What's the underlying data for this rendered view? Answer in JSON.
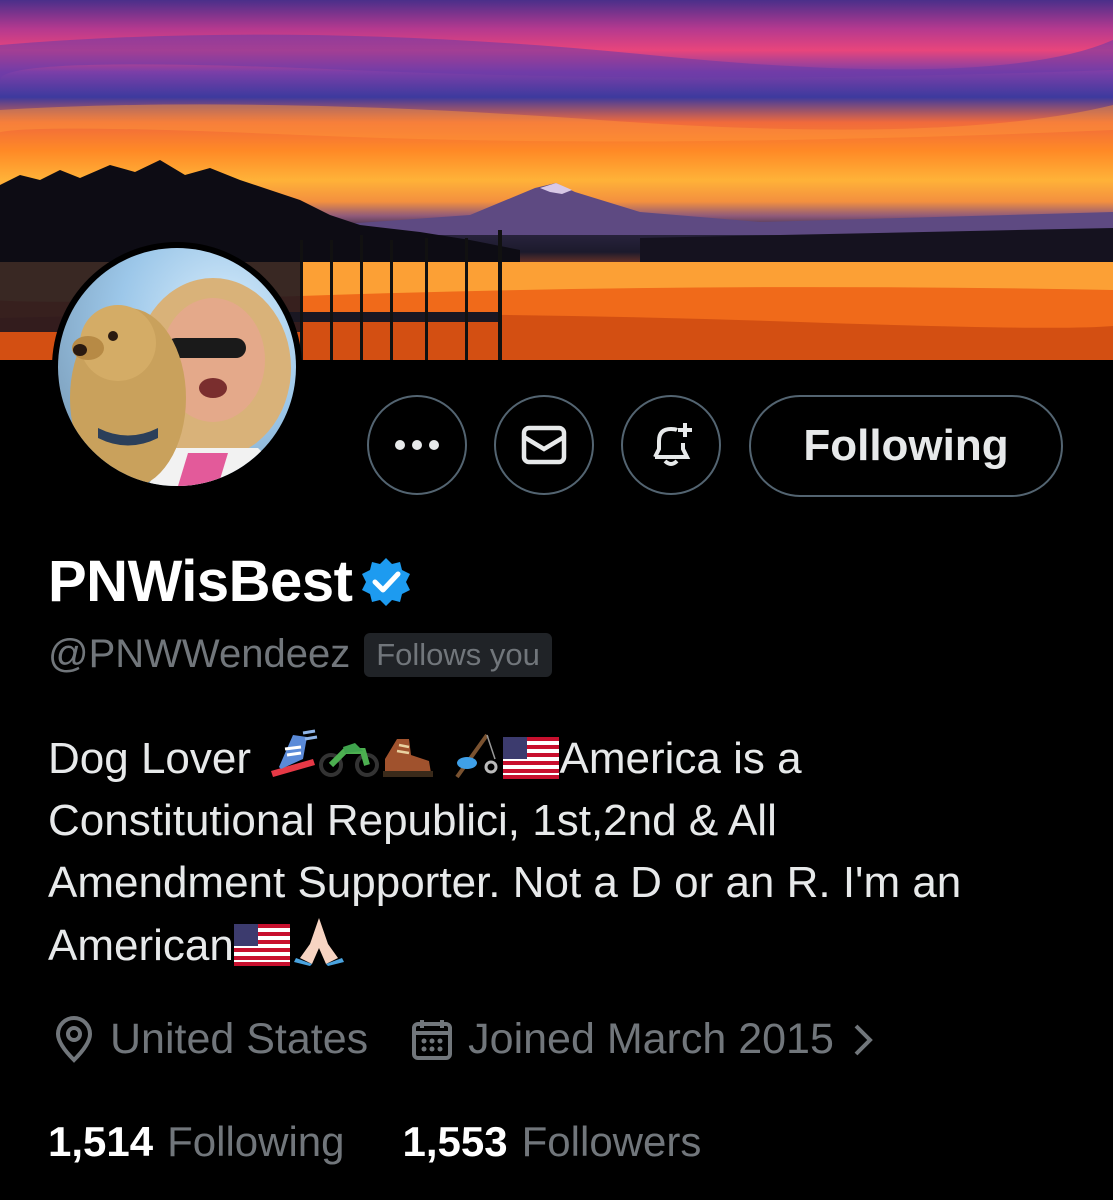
{
  "profile": {
    "display_name": "PNWisBest",
    "handle": "@PNWWendeez",
    "follows_you_badge": "Follows you",
    "verified_icon": "verified-badge-icon"
  },
  "actions": {
    "more_icon": "more-icon",
    "message_icon": "message-icon",
    "notify_icon": "notification-bell-add-icon",
    "follow_button_label": "Following"
  },
  "bio": {
    "line1_start": "Dog Lover ",
    "line1_emojis": [
      "ski-boot-icon",
      "motorcycle-icon",
      "hiking-boot-icon",
      "fishing-pole-icon",
      "us-flag-icon"
    ],
    "line1_end": "America is a",
    "line2": "Constitutional Republici, 1st,2nd & All",
    "line3": "Amendment Supporter. Not a D or an R. I'm an",
    "line4_start": "American",
    "line4_emojis": [
      "us-flag-icon",
      "folded-hands-icon"
    ]
  },
  "meta": {
    "location": "United States",
    "joined": "Joined March 2015"
  },
  "stats": {
    "following_count": "1,514",
    "following_label": "Following",
    "followers_count": "1,553",
    "followers_label": "Followers"
  },
  "colors": {
    "background": "#000000",
    "text_primary": "#e7e9ea",
    "text_secondary": "#71767b",
    "border": "#536471",
    "verified_blue": "#1d9bf0"
  }
}
